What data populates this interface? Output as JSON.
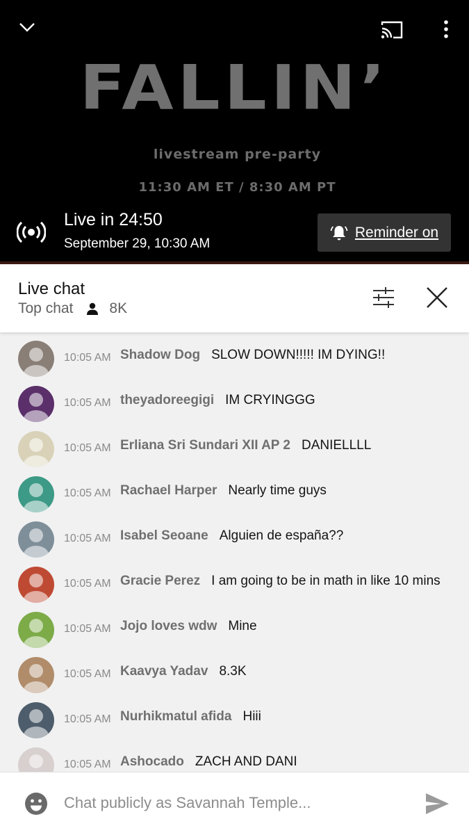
{
  "video": {
    "poster_title": "FALLIN’",
    "poster_subtitle": "livestream pre-party",
    "poster_time": "11:30 AM ET / 8:30 AM PT",
    "live_status": "Live in 24:50",
    "scheduled_date": "September 29, 10:30 AM",
    "reminder_label": "Reminder on",
    "icons": [
      "chevron-down-icon",
      "cast-icon",
      "more-vert-icon",
      "live-broadcast-icon",
      "bell-icon"
    ]
  },
  "chat_header": {
    "title": "Live chat",
    "mode": "Top chat",
    "viewers": "8K",
    "icons": [
      "person-icon",
      "filter-icon",
      "close-icon"
    ]
  },
  "messages": [
    {
      "time": "10:05 AM",
      "author": "Shadow Dog",
      "text": "SLOW DOWN!!!!! IM DYING!!",
      "avatar_color": "#8a7f76"
    },
    {
      "time": "10:05 AM",
      "author": "theyadoreegigi",
      "text": "IM CRYINGGG",
      "avatar_color": "#5a2f6a"
    },
    {
      "time": "10:05 AM",
      "author": "Erliana Sri Sundari XII AP 2",
      "text": "DANIELLLL",
      "avatar_color": "#d9d2b8"
    },
    {
      "time": "10:05 AM",
      "author": "Rachael Harper",
      "text": "Nearly time guys",
      "avatar_color": "#3d9a86"
    },
    {
      "time": "10:05 AM",
      "author": "Isabel Seoane",
      "text": "Alguien de españa??",
      "avatar_color": "#7f8f9a"
    },
    {
      "time": "10:05 AM",
      "author": "Gracie Perez",
      "text": "I am going to be in math in like 10 mins",
      "avatar_color": "#bf4a33"
    },
    {
      "time": "10:05 AM",
      "author": "Jojo loves wdw",
      "text": "Mine",
      "avatar_color": "#7cab48"
    },
    {
      "time": "10:05 AM",
      "author": "Kaavya Yadav",
      "text": "8.3K",
      "avatar_color": "#b08c6a"
    },
    {
      "time": "10:05 AM",
      "author": "Nurhikmatul afida",
      "text": "Hiii",
      "avatar_color": "#4e5d6c"
    },
    {
      "time": "10:05 AM",
      "author": "Ashocado",
      "text": "ZACH AND DANI",
      "avatar_color": "#d8cfcf"
    }
  ],
  "input": {
    "placeholder": "Chat publicly as Savannah Temple...",
    "icons": [
      "emoji-icon",
      "send-icon"
    ]
  }
}
